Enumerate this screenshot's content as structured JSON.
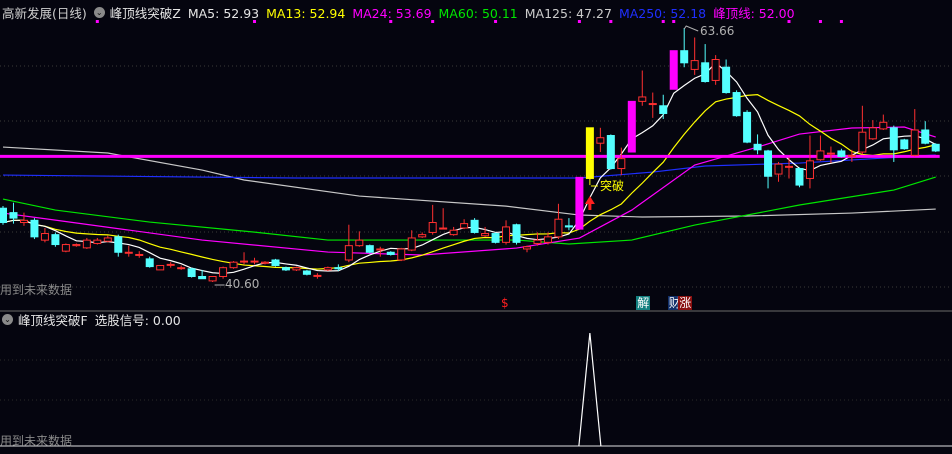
{
  "header": {
    "stock": "高新发展(日线)",
    "indicator": "峰顶线突破Z",
    "items": [
      {
        "label": "MA5: 52.93",
        "color": "#e6e6e6"
      },
      {
        "label": "MA13: 52.94",
        "color": "#ffff00"
      },
      {
        "label": "MA24: 53.69",
        "color": "#ff00ff"
      },
      {
        "label": "MA60: 50.11",
        "color": "#00e600"
      },
      {
        "label": "MA125: 47.27",
        "color": "#cccccc"
      },
      {
        "label": "MA250: 52.18",
        "color": "#1f2fff"
      },
      {
        "label": "峰顶线: 52.00",
        "color": "#ff00ff"
      }
    ]
  },
  "sub_header": {
    "indicator": "峰顶线突破F",
    "value": "选股信号: 0.00"
  },
  "future_note": "用到未来数据",
  "annotations": {
    "high": "63.66",
    "low": "40.60",
    "breakout": "突破"
  },
  "signals": [
    {
      "text": "$",
      "index": 48,
      "color": "#ff2020",
      "bg": "transparent"
    },
    {
      "text": "解",
      "index": 61,
      "color": "#ffffff",
      "bg": "#138080"
    },
    {
      "text": "财",
      "index": 64,
      "color": "#ffffff",
      "bg": "#12306a"
    },
    {
      "text": "涨",
      "index": 65,
      "color": "#ffffff",
      "bg": "#8a1010"
    }
  ],
  "chart_data": {
    "type": "candlestick",
    "price_range": [
      40.6,
      63.66
    ],
    "candles_ohlc": [
      [
        47.3,
        46.0,
        47.5,
        45.8
      ],
      [
        46.9,
        46.4,
        47.8,
        45.9
      ],
      [
        46.0,
        46.2,
        46.9,
        45.7
      ],
      [
        46.2,
        44.7,
        46.4,
        44.5
      ],
      [
        44.4,
        45.0,
        45.5,
        44.2
      ],
      [
        44.9,
        44.0,
        45.1,
        43.8
      ],
      [
        43.4,
        44.0,
        44.1,
        43.3
      ],
      [
        43.9,
        44.0,
        44.1,
        43.8
      ],
      [
        43.7,
        44.4,
        44.6,
        43.6
      ],
      [
        44.1,
        44.4,
        44.6,
        44.0
      ],
      [
        44.3,
        44.6,
        44.8,
        44.2
      ],
      [
        44.7,
        43.3,
        44.9,
        42.9
      ],
      [
        43.3,
        43.3,
        43.9,
        42.9
      ],
      [
        43.1,
        43.1,
        43.4,
        42.8
      ],
      [
        42.7,
        42.0,
        42.9,
        41.9
      ],
      [
        41.7,
        42.1,
        42.1,
        41.7
      ],
      [
        42.2,
        42.2,
        42.4,
        41.9
      ],
      [
        41.9,
        41.9,
        42.1,
        41.7
      ],
      [
        41.8,
        41.1,
        41.9,
        41.0
      ],
      [
        41.1,
        40.9,
        41.7,
        40.9
      ],
      [
        40.7,
        41.1,
        41.1,
        40.6
      ],
      [
        41.1,
        41.9,
        42.0,
        40.9
      ],
      [
        41.9,
        42.4,
        42.5,
        41.8
      ],
      [
        42.5,
        42.5,
        43.3,
        42.2
      ],
      [
        42.5,
        42.5,
        42.8,
        42.2
      ],
      [
        42.3,
        42.4,
        42.5,
        42.2
      ],
      [
        42.6,
        42.1,
        42.7,
        42.0
      ],
      [
        41.9,
        41.7,
        42.0,
        41.6
      ],
      [
        41.7,
        41.9,
        42.0,
        41.6
      ],
      [
        41.6,
        41.3,
        41.7,
        41.2
      ],
      [
        41.2,
        41.2,
        41.4,
        40.9
      ],
      [
        41.7,
        41.9,
        42.0,
        41.6
      ],
      [
        41.9,
        41.8,
        42.2,
        41.6
      ],
      [
        42.6,
        43.9,
        45.8,
        42.4
      ],
      [
        43.9,
        44.4,
        45.2,
        43.8
      ],
      [
        43.9,
        43.3,
        44.0,
        43.2
      ],
      [
        43.6,
        43.6,
        43.8,
        42.9
      ],
      [
        43.3,
        43.1,
        43.4,
        43.0
      ],
      [
        42.6,
        43.6,
        43.7,
        42.5
      ],
      [
        43.5,
        44.6,
        45.3,
        43.4
      ],
      [
        44.7,
        44.9,
        45.1,
        44.6
      ],
      [
        45.1,
        46.0,
        47.6,
        44.9
      ],
      [
        45.5,
        45.5,
        47.3,
        45.4
      ],
      [
        44.9,
        45.3,
        45.6,
        44.8
      ],
      [
        45.5,
        45.9,
        46.3,
        45.4
      ],
      [
        46.2,
        45.1,
        46.4,
        45.0
      ],
      [
        44.8,
        45.0,
        45.6,
        44.7
      ],
      [
        45.0,
        44.2,
        45.1,
        44.1
      ],
      [
        44.2,
        45.6,
        46.2,
        44.0
      ],
      [
        45.8,
        44.2,
        45.9,
        44.0
      ],
      [
        43.6,
        43.8,
        43.9,
        43.3
      ],
      [
        44.1,
        44.4,
        45.1,
        43.9
      ],
      [
        44.2,
        44.7,
        45.1,
        44.0
      ],
      [
        44.7,
        46.3,
        47.7,
        44.5
      ],
      [
        45.7,
        45.6,
        46.4,
        45.3
      ],
      [
        45.4,
        50.1,
        50.1,
        45.4
      ],
      [
        50.0,
        54.6,
        54.6,
        49.4
      ],
      [
        53.2,
        53.7,
        54.6,
        52.4
      ],
      [
        53.9,
        50.9,
        54.0,
        50.8
      ],
      [
        50.9,
        51.8,
        52.8,
        50.3
      ],
      [
        52.4,
        57.0,
        57.0,
        52.4
      ],
      [
        57.0,
        57.4,
        59.8,
        56.6
      ],
      [
        56.8,
        56.8,
        57.8,
        55.5
      ],
      [
        56.6,
        55.9,
        57.6,
        55.4
      ],
      [
        58.1,
        61.6,
        61.6,
        58.1
      ],
      [
        61.6,
        60.5,
        63.66,
        60.1
      ],
      [
        59.9,
        60.7,
        62.8,
        59.4
      ],
      [
        60.5,
        58.8,
        62.2,
        58.7
      ],
      [
        58.9,
        60.8,
        61.2,
        58.5
      ],
      [
        60.1,
        57.8,
        60.8,
        57.7
      ],
      [
        57.8,
        55.7,
        58.0,
        55.6
      ],
      [
        56.0,
        53.3,
        56.2,
        53.2
      ],
      [
        53.1,
        52.6,
        54.0,
        52.2
      ],
      [
        52.5,
        50.2,
        52.6,
        49.1
      ],
      [
        50.4,
        51.3,
        51.5,
        49.7
      ],
      [
        51.1,
        51.1,
        51.9,
        50.0
      ],
      [
        50.9,
        49.4,
        51.0,
        49.2
      ],
      [
        50.0,
        51.6,
        53.9,
        49.1
      ],
      [
        51.7,
        52.5,
        53.9,
        51.6
      ],
      [
        52.3,
        52.3,
        52.9,
        51.4
      ],
      [
        52.5,
        52.0,
        52.7,
        51.9
      ],
      [
        52.1,
        52.1,
        52.6,
        51.5
      ],
      [
        52.4,
        54.2,
        56.6,
        52.2
      ],
      [
        53.6,
        54.6,
        55.3,
        53.5
      ],
      [
        54.5,
        55.1,
        55.8,
        54.4
      ],
      [
        54.6,
        52.6,
        54.8,
        51.5
      ],
      [
        53.5,
        52.7,
        53.6,
        52.6
      ],
      [
        52.1,
        54.4,
        56.3,
        52.0
      ],
      [
        54.4,
        53.2,
        55.2,
        53.1
      ],
      [
        53.1,
        52.5,
        53.2,
        52.4
      ]
    ],
    "special_candles": {
      "limit_up": [
        55,
        60,
        64
      ],
      "breakout": [
        56
      ]
    },
    "ma_lines": {
      "MA24": [
        [
          0,
          46.86
        ],
        [
          5,
          46.22
        ],
        [
          19,
          44.41
        ],
        [
          31,
          43.32
        ],
        [
          40,
          43.05
        ],
        [
          49,
          43.68
        ],
        [
          55,
          44.59
        ],
        [
          60,
          47.13
        ],
        [
          66,
          51.22
        ],
        [
          72,
          52.85
        ],
        [
          76,
          54.03
        ],
        [
          81,
          54.58
        ],
        [
          86,
          54.67
        ],
        [
          89,
          53.76
        ]
      ],
      "MA60": [
        [
          0,
          48.13
        ],
        [
          5,
          47.13
        ],
        [
          14,
          46.04
        ],
        [
          24,
          45.13
        ],
        [
          31,
          44.41
        ],
        [
          49,
          44.41
        ],
        [
          54,
          44.05
        ],
        [
          60,
          44.41
        ],
        [
          66,
          45.77
        ],
        [
          76,
          47.59
        ],
        [
          85,
          48.95
        ],
        [
          89,
          50.13
        ]
      ],
      "MA125": [
        [
          0,
          52.85
        ],
        [
          10,
          52.31
        ],
        [
          19,
          50.76
        ],
        [
          23,
          49.86
        ],
        [
          34,
          48.4
        ],
        [
          48,
          47.49
        ],
        [
          55,
          46.68
        ],
        [
          61,
          46.5
        ],
        [
          71,
          46.59
        ],
        [
          81,
          46.86
        ],
        [
          89,
          47.22
        ]
      ],
      "MA250": [
        [
          0,
          50.31
        ],
        [
          28,
          50.04
        ],
        [
          55,
          50.04
        ],
        [
          62,
          50.58
        ],
        [
          67,
          51.13
        ],
        [
          76,
          51.4
        ],
        [
          89,
          52.13
        ]
      ]
    },
    "peak_line": 52.0,
    "top_markers": [
      9,
      24,
      37,
      41,
      47,
      55,
      58,
      63,
      64,
      75,
      78,
      80
    ],
    "signal_series": {
      "index": 56,
      "value": 1
    }
  }
}
